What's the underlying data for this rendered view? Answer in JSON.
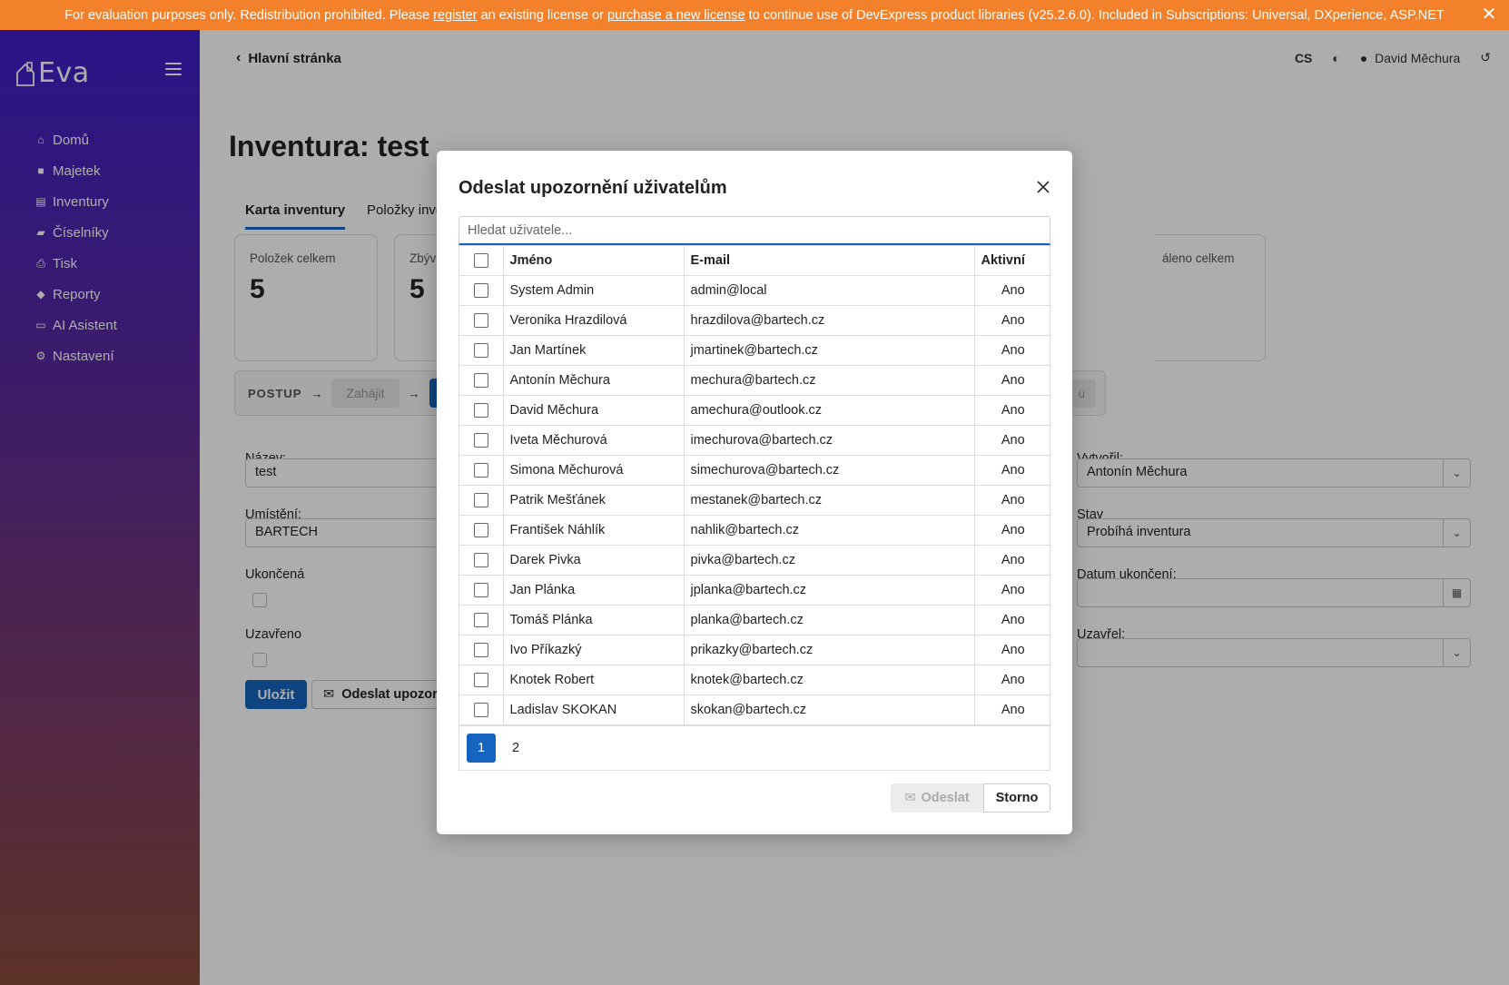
{
  "banner": {
    "text_before": "For evaluation purposes only. Redistribution prohibited. Please ",
    "link_register": "register",
    "text_mid": " an existing license or ",
    "link_purchase": "purchase a new license",
    "text_after": " to continue use of DevExpress product libraries (v25.2.6.0). Included in Subscriptions: Universal, DXperience, ASP.NET"
  },
  "sidebar": {
    "logo_text": "Eva",
    "items": [
      {
        "label": "Domů",
        "icon": "home-icon"
      },
      {
        "label": "Majetek",
        "icon": "box-icon"
      },
      {
        "label": "Inventury",
        "icon": "clipboard-icon"
      },
      {
        "label": "Číselníky",
        "icon": "folder-icon"
      },
      {
        "label": "Tisk",
        "icon": "printer-icon"
      },
      {
        "label": "Reporty",
        "icon": "tag-icon"
      },
      {
        "label": "AI Asistent",
        "icon": "chat-icon"
      },
      {
        "label": "Nastavení",
        "icon": "gear-icon"
      }
    ]
  },
  "header": {
    "back_label": "Hlavní stránka",
    "language": "CS",
    "user_name": "David Měchura"
  },
  "page": {
    "title": "Inventura: test",
    "tabs": [
      "Karta inventury",
      "Položky inver"
    ],
    "cards": [
      {
        "label": "Položek celkem",
        "value": "5"
      },
      {
        "label": "Zbýv",
        "value": "5"
      },
      {
        "label": "áleno celkem",
        "value": ""
      }
    ],
    "process": {
      "label": "POSTUP",
      "step1": "Zahájit",
      "step_tail": "u"
    },
    "form": {
      "name_label": "Název:",
      "name_value": "test",
      "location_label": "Umístění:",
      "location_value": "BARTECH",
      "finished_label": "Ukončená",
      "closed_label": "Uzavřeno",
      "created_by_label": "Vytvořil:",
      "created_by_value": "Antonín  Měchura",
      "state_label": "Stav",
      "state_value": "Probíhá inventura",
      "end_date_label": "Datum ukončení:",
      "closed_by_label": "Uzavřel:"
    },
    "save_label": "Uložit",
    "notify_label": "Odeslat upozorn"
  },
  "modal": {
    "title": "Odeslat upozornění uživatelům",
    "search_placeholder": "Hledat uživatele...",
    "columns": {
      "name": "Jméno",
      "email": "E-mail",
      "active": "Aktivní"
    },
    "rows": [
      {
        "name": "System Admin",
        "email": "admin@local",
        "active": "Ano"
      },
      {
        "name": "Veronika Hrazdilová",
        "email": "hrazdilova@bartech.cz",
        "active": "Ano"
      },
      {
        "name": "Jan Martínek",
        "email": "jmartinek@bartech.cz",
        "active": "Ano"
      },
      {
        "name": "Antonín Měchura",
        "email": "mechura@bartech.cz",
        "active": "Ano"
      },
      {
        "name": "David Měchura",
        "email": "amechura@outlook.cz",
        "active": "Ano"
      },
      {
        "name": "Iveta Měchurová",
        "email": "imechurova@bartech.cz",
        "active": "Ano"
      },
      {
        "name": "Simona Měchurová",
        "email": "simechurova@bartech.cz",
        "active": "Ano"
      },
      {
        "name": "Patrik Mešťánek",
        "email": "mestanek@bartech.cz",
        "active": "Ano"
      },
      {
        "name": "František Náhlík",
        "email": "nahlik@bartech.cz",
        "active": "Ano"
      },
      {
        "name": "Darek Pivka",
        "email": "pivka@bartech.cz",
        "active": "Ano"
      },
      {
        "name": "Jan Plánka",
        "email": "jplanka@bartech.cz",
        "active": "Ano"
      },
      {
        "name": "Tomáš Plánka",
        "email": "planka@bartech.cz",
        "active": "Ano"
      },
      {
        "name": "Ivo Příkazký",
        "email": "prikazky@bartech.cz",
        "active": "Ano"
      },
      {
        "name": "Knotek Robert",
        "email": "knotek@bartech.cz",
        "active": "Ano"
      },
      {
        "name": "Ladislav SKOKAN",
        "email": "skokan@bartech.cz",
        "active": "Ano"
      }
    ],
    "pages": [
      "1",
      "2"
    ],
    "send_label": "Odeslat",
    "cancel_label": "Storno"
  },
  "colors": {
    "banner": "#f3802a",
    "accent": "#1565c0",
    "sidebar_top": "#3f1fc9",
    "sidebar_bottom": "#8a4a3a"
  }
}
